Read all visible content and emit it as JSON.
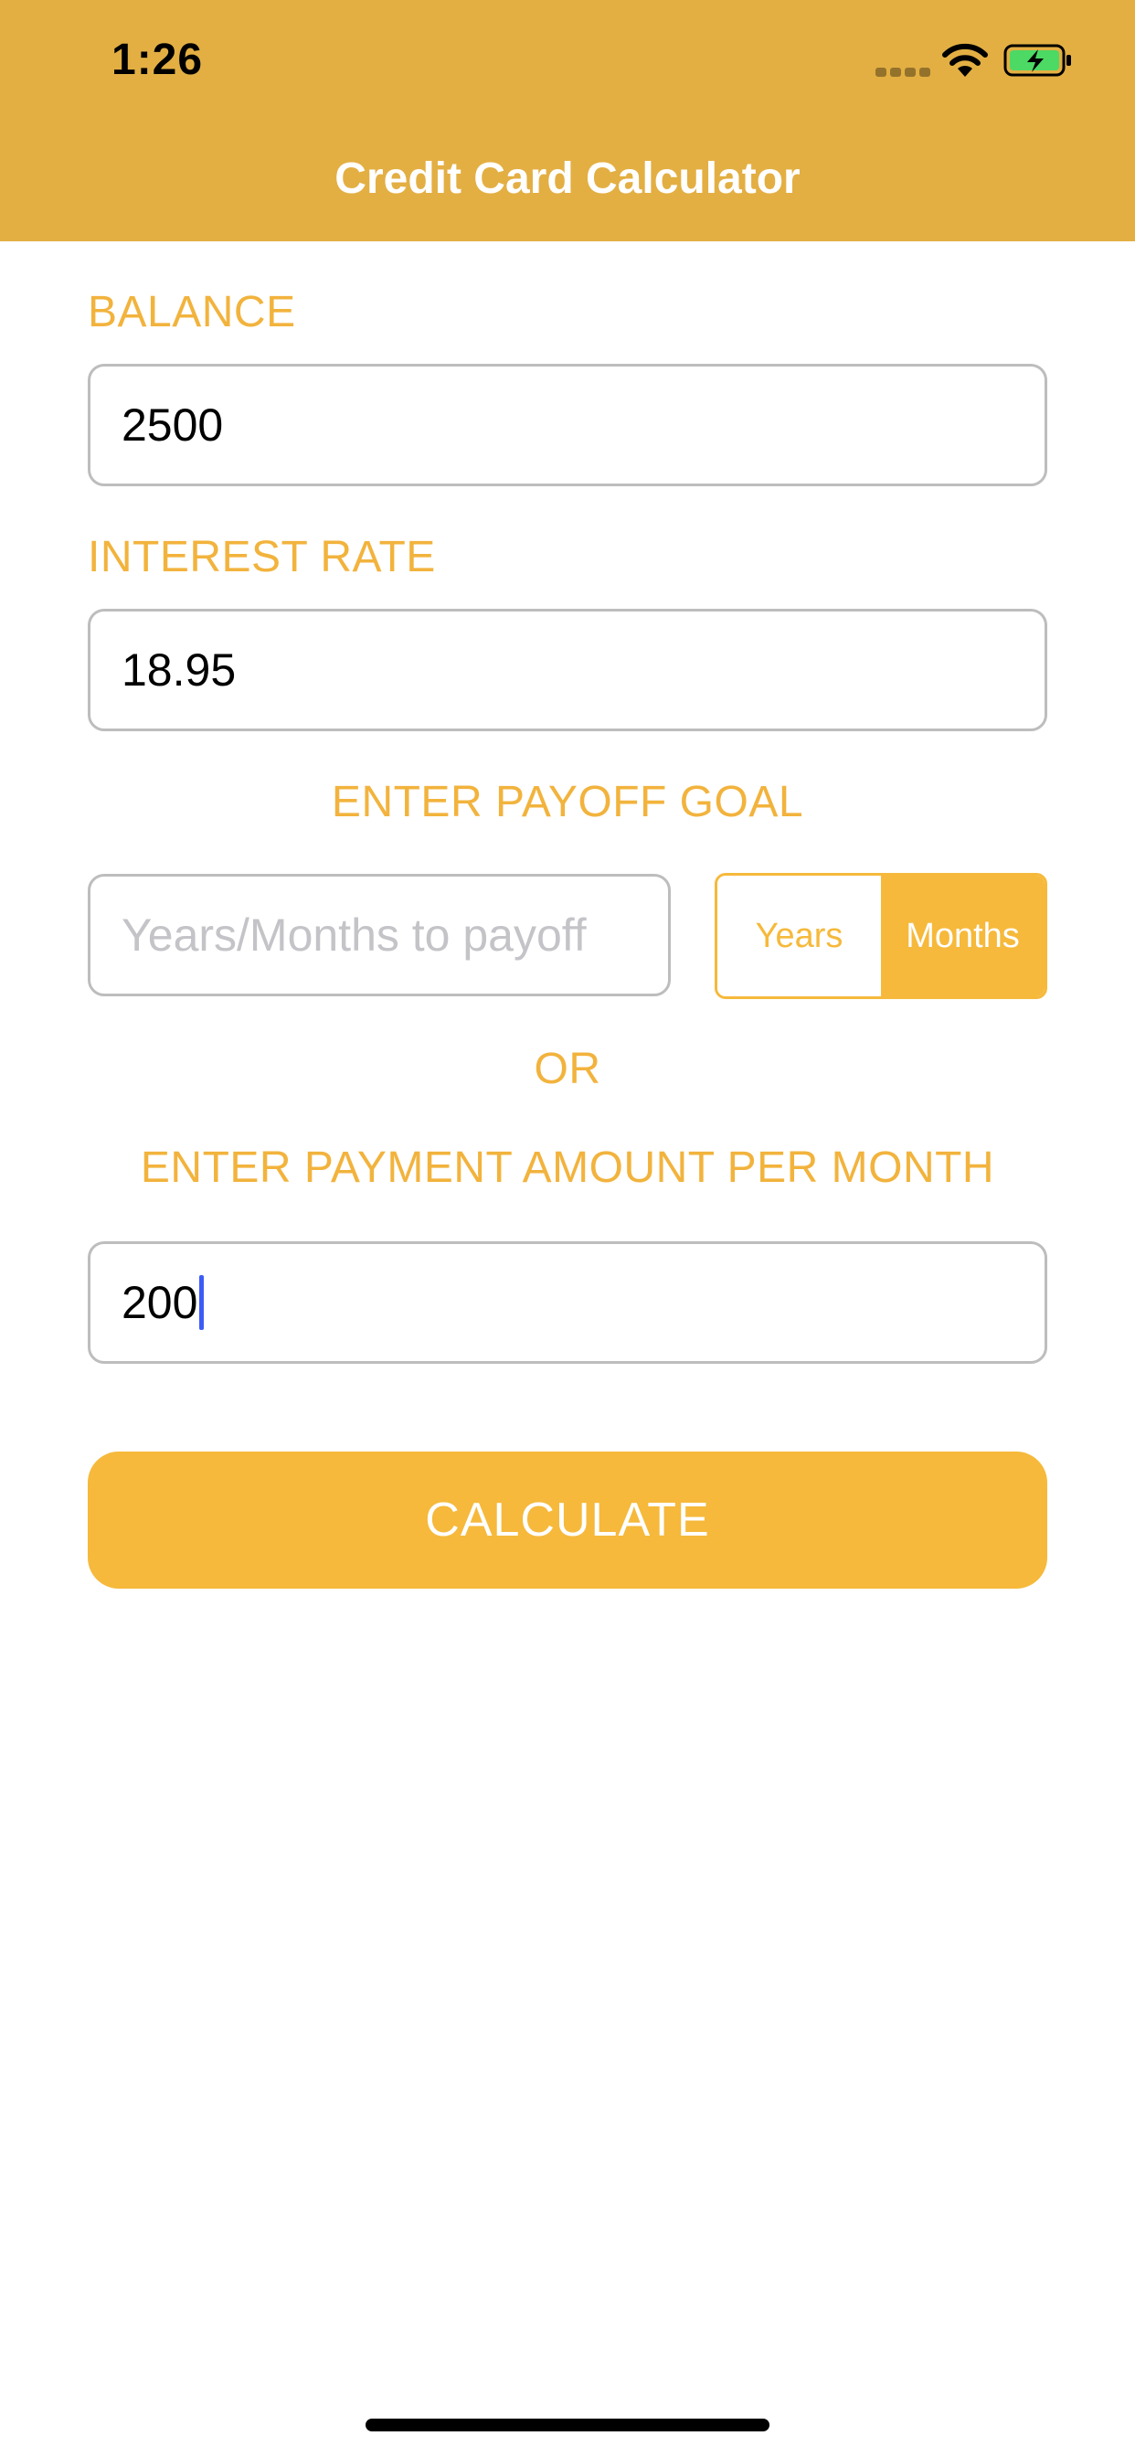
{
  "status_bar": {
    "time": "1:26",
    "battery_color": "#4cd964"
  },
  "nav": {
    "title": "Credit Card Calculator",
    "background": "#e3af43"
  },
  "form": {
    "balance_label": "BALANCE",
    "balance_value": "2500",
    "interest_label": "INTEREST RATE",
    "interest_value": "18.95",
    "payoff_goal_label": "ENTER PAYOFF GOAL",
    "payoff_placeholder": "Years/Months to payoff",
    "period_options": [
      "Years",
      "Months"
    ],
    "period_selected": "Months",
    "or_label": "OR",
    "payment_label": "ENTER PAYMENT AMOUNT PER MONTH",
    "payment_value": "200",
    "calculate_label": "CALCULATE",
    "accent_color": "#f6b93b"
  }
}
